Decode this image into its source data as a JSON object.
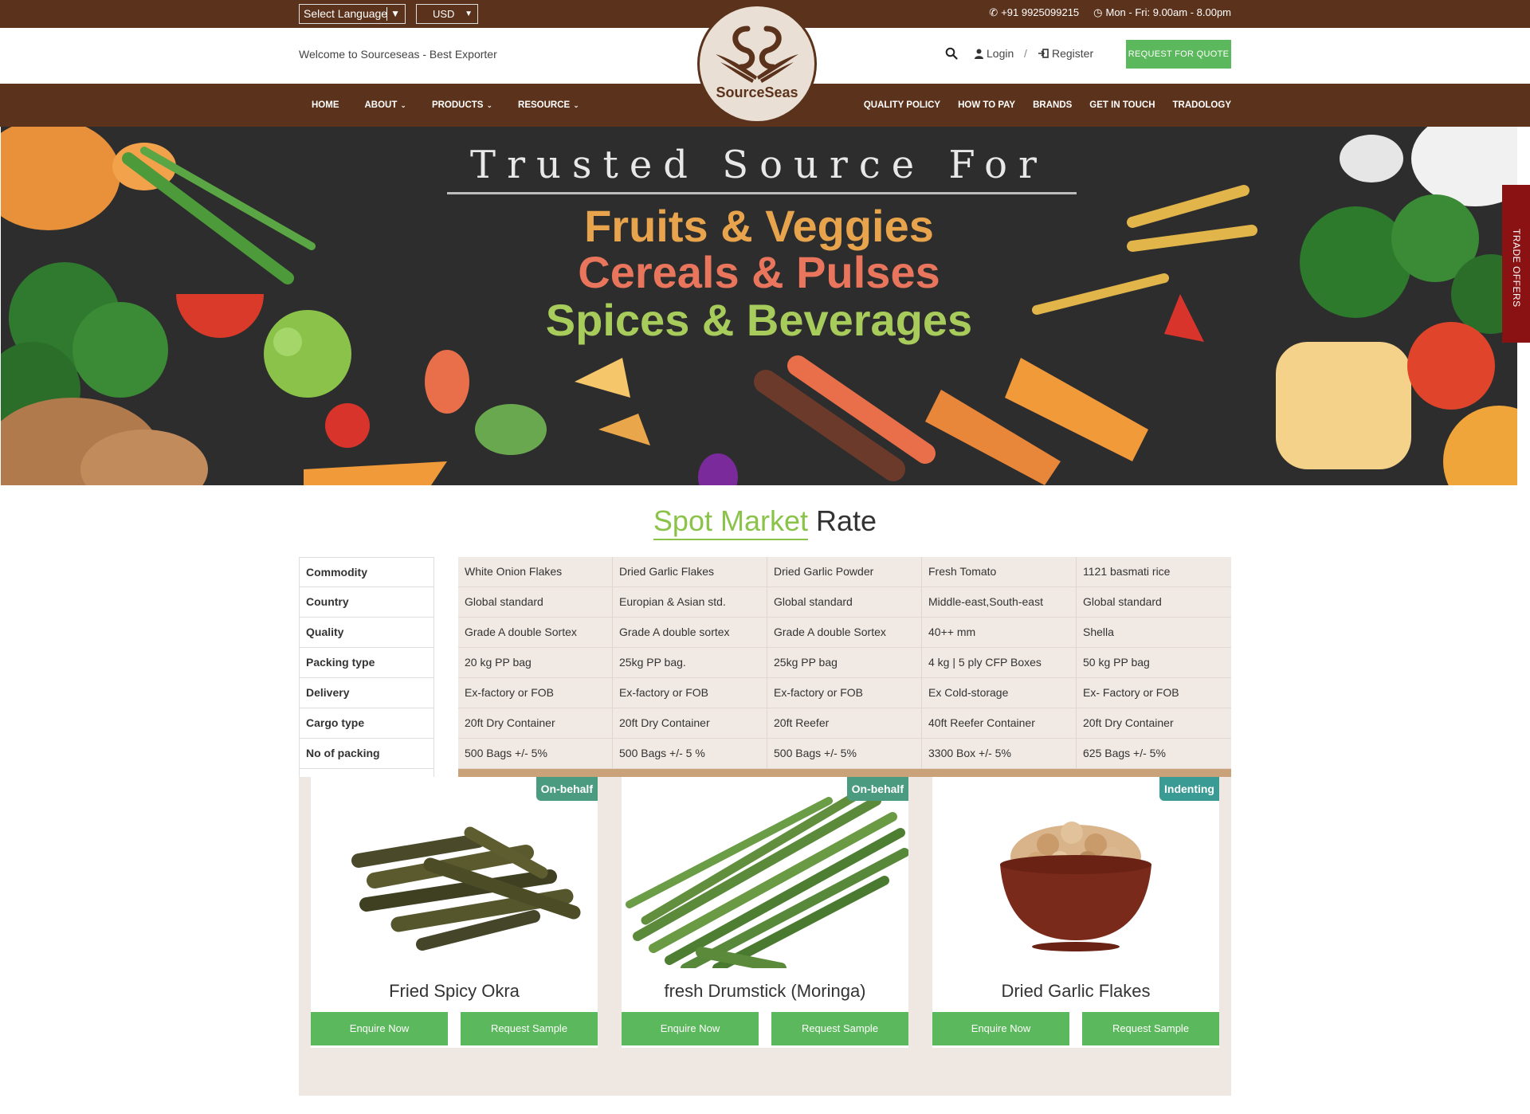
{
  "topbar": {
    "language": "Select Language",
    "currency": "USD",
    "phone": "+91 9925099215",
    "hours": "Mon - Fri: 9.00am - 8.00pm"
  },
  "header": {
    "welcome": "Welcome to Sourceseas - Best Exporter",
    "login": "Login",
    "slash": "/",
    "register": "Register",
    "rfq": "REQUEST FOR QUOTE",
    "logo_text": "SourceSeas"
  },
  "nav": {
    "left": [
      "HOME",
      "ABOUT",
      "PRODUCTS",
      "RESOURCE"
    ],
    "right": [
      "QUALITY POLICY",
      "HOW TO PAY",
      "BRANDS",
      "GET IN TOUCH",
      "TRADOLOGY"
    ]
  },
  "banner": {
    "line1": "Trusted Source For",
    "line2": "Fruits & Veggies",
    "line3": "Cereals & Pulses",
    "line4": "Spices & Beverages"
  },
  "trade_offers": "TRADE OFFERS",
  "spot": {
    "title_green": "Spot Market",
    "title_dark": "Rate",
    "labels": [
      "Commodity",
      "Country",
      "Quality",
      "Packing type",
      "Delivery",
      "Cargo type",
      "No of packing"
    ],
    "columns": [
      [
        "White Onion Flakes",
        "Global standard",
        "Grade A double Sortex",
        "20 kg PP bag",
        "Ex-factory or FOB",
        "20ft Dry Container",
        "500 Bags +/- 5%"
      ],
      [
        "Dried Garlic Flakes",
        "Europian & Asian std.",
        "Grade A double sortex",
        "25kg PP bag.",
        "Ex-factory or FOB",
        "20ft Dry Container",
        "500 Bags +/- 5 %"
      ],
      [
        "Dried Garlic Powder",
        "Global standard",
        "Grade A double Sortex",
        "25kg PP bag",
        "Ex-factory or FOB",
        "20ft Reefer",
        "500 Bags +/- 5%"
      ],
      [
        "Fresh Tomato",
        "Middle-east,South-east",
        "40++ mm",
        "4 kg | 5 ply CFP Boxes",
        "Ex Cold-storage",
        "40ft Reefer Container",
        "3300 Box +/- 5%"
      ],
      [
        "1121 basmati rice",
        "Global standard",
        "Shella",
        "50 kg PP bag",
        "Ex- Factory or FOB",
        "20ft Dry Container",
        "625 Bags +/- 5%"
      ]
    ]
  },
  "products": [
    {
      "name": "Fried Spicy Okra",
      "badge": "On-behalf",
      "enquire": "Enquire Now",
      "sample": "Request Sample"
    },
    {
      "name": "fresh Drumstick (Moringa)",
      "badge": "On-behalf",
      "enquire": "Enquire Now",
      "sample": "Request Sample"
    },
    {
      "name": "Dried Garlic Flakes",
      "badge": "Indenting",
      "enquire": "Enquire Now",
      "sample": "Request Sample"
    }
  ]
}
